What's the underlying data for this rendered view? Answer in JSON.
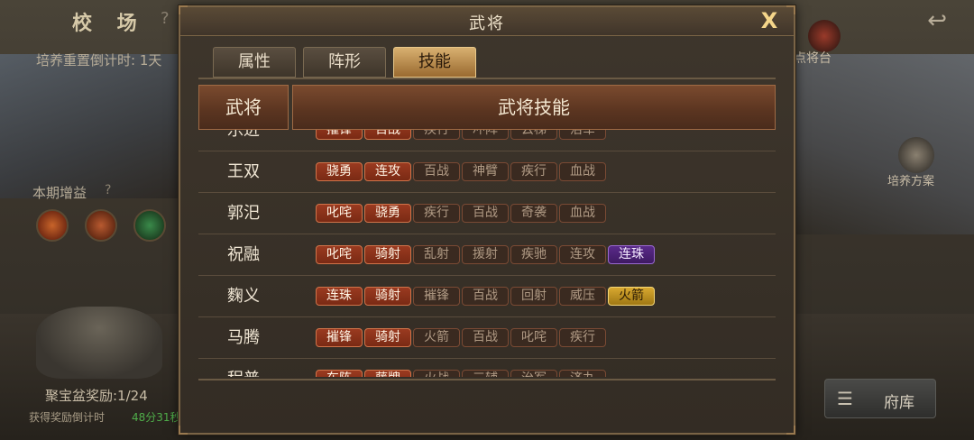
{
  "background": {
    "title": "校 场",
    "help_mark": "?",
    "reset_text": "培养重置倒计时: 1天",
    "period_bonus": "本期增益",
    "period_help": "?",
    "reward_text": "聚宝盆奖励:1/24",
    "countdown_label": "获得奖励倒计时",
    "countdown_value": "48分31秒",
    "general_label": "点将台",
    "plan_label": "培养方案",
    "storage_label": "府库",
    "back_icon": "back-arrow-icon",
    "storage_icon": "storage-icon"
  },
  "dialog": {
    "title": "武将",
    "close_label": "X",
    "tabs": [
      {
        "label": "属性",
        "active": false
      },
      {
        "label": "阵形",
        "active": false
      },
      {
        "label": "技能",
        "active": true
      }
    ],
    "headers": {
      "general": "武将",
      "skills": "武将技能"
    },
    "rows": [
      {
        "name": "乐进",
        "skills": [
          {
            "label": "摧锋",
            "style": "red"
          },
          {
            "label": "百战",
            "style": "red"
          },
          {
            "label": "疾行",
            "style": "dim"
          },
          {
            "label": "冲阵",
            "style": "dim"
          },
          {
            "label": "云梯",
            "style": "dim"
          },
          {
            "label": "治军",
            "style": "dim"
          }
        ]
      },
      {
        "name": "王双",
        "skills": [
          {
            "label": "骁勇",
            "style": "red"
          },
          {
            "label": "连攻",
            "style": "red"
          },
          {
            "label": "百战",
            "style": "dim"
          },
          {
            "label": "神臂",
            "style": "dim"
          },
          {
            "label": "疾行",
            "style": "dim"
          },
          {
            "label": "血战",
            "style": "dim"
          }
        ]
      },
      {
        "name": "郭汜",
        "skills": [
          {
            "label": "叱咤",
            "style": "red"
          },
          {
            "label": "骁勇",
            "style": "red"
          },
          {
            "label": "疾行",
            "style": "dim"
          },
          {
            "label": "百战",
            "style": "dim"
          },
          {
            "label": "奇袭",
            "style": "dim"
          },
          {
            "label": "血战",
            "style": "dim"
          }
        ]
      },
      {
        "name": "祝融",
        "skills": [
          {
            "label": "叱咤",
            "style": "red"
          },
          {
            "label": "骑射",
            "style": "red"
          },
          {
            "label": "乱射",
            "style": "dim"
          },
          {
            "label": "援射",
            "style": "dim"
          },
          {
            "label": "疾驰",
            "style": "dim"
          },
          {
            "label": "连攻",
            "style": "dim"
          },
          {
            "label": "连珠",
            "style": "purple"
          }
        ]
      },
      {
        "name": "麴义",
        "skills": [
          {
            "label": "连珠",
            "style": "red"
          },
          {
            "label": "骑射",
            "style": "red"
          },
          {
            "label": "摧锋",
            "style": "dim"
          },
          {
            "label": "百战",
            "style": "dim"
          },
          {
            "label": "回射",
            "style": "dim"
          },
          {
            "label": "威压",
            "style": "dim"
          },
          {
            "label": "火箭",
            "style": "gold"
          }
        ]
      },
      {
        "name": "马腾",
        "skills": [
          {
            "label": "摧锋",
            "style": "red"
          },
          {
            "label": "骑射",
            "style": "red"
          },
          {
            "label": "火箭",
            "style": "dim"
          },
          {
            "label": "百战",
            "style": "dim"
          },
          {
            "label": "叱咤",
            "style": "dim"
          },
          {
            "label": "疾行",
            "style": "dim"
          }
        ]
      },
      {
        "name": "程普",
        "skills": [
          {
            "label": "车阵",
            "style": "red"
          },
          {
            "label": "藤牌",
            "style": "red"
          },
          {
            "label": "火战",
            "style": "dim"
          },
          {
            "label": "三辅",
            "style": "dim"
          },
          {
            "label": "治军",
            "style": "dim"
          },
          {
            "label": "济丸",
            "style": "dim"
          }
        ]
      }
    ]
  },
  "colors": {
    "tab_active": "#d8b070",
    "skill_red": "#9a3a20",
    "skill_purple": "#5a2a8a",
    "skill_gold": "#d8a830",
    "countdown_green": "#4fae4a"
  }
}
